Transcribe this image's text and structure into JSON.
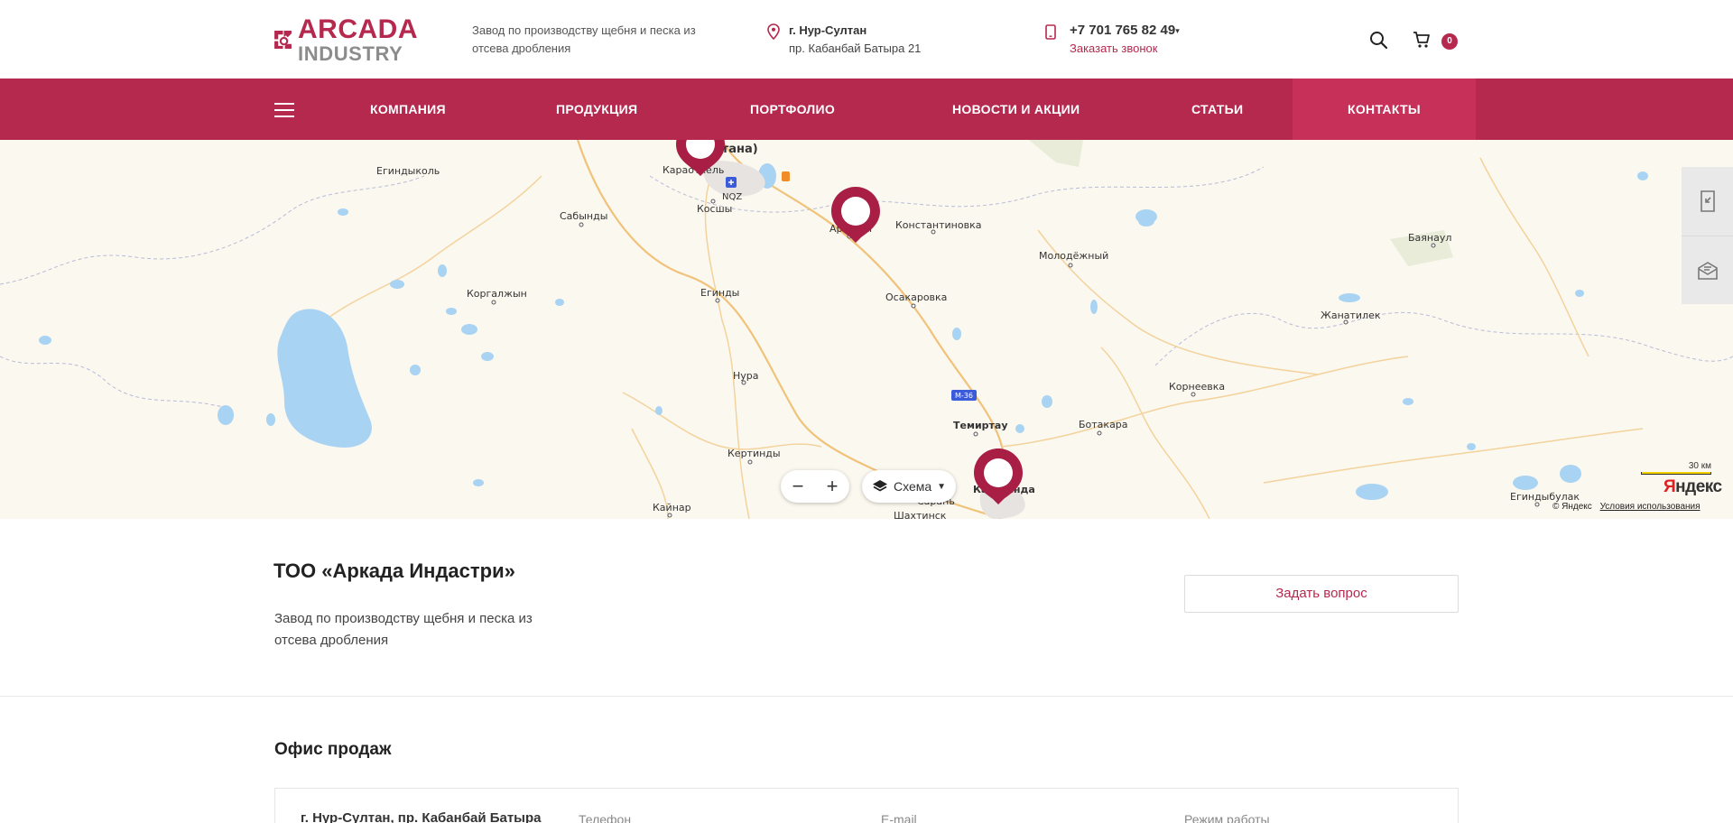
{
  "header": {
    "logo_line1": "ARCADA",
    "logo_line2": "INDUSTRY",
    "tagline": "Завод по производству щебня и песка из отсева дробления",
    "address_city": "г. Нур-Султан",
    "address_street": "пр. Кабанбай Батыра 21",
    "phone": "+7 701 765 82 49",
    "callback_label": "Заказать звонок",
    "cart_count": "0",
    "accent_color": "#b5294f"
  },
  "nav": {
    "items": [
      {
        "label": "Компания"
      },
      {
        "label": "Продукция"
      },
      {
        "label": "Портфолио"
      },
      {
        "label": "Новости и акции"
      },
      {
        "label": "Статьи"
      },
      {
        "label": "Контакты",
        "active": true
      }
    ]
  },
  "map": {
    "layer_label": "Схема",
    "scale_label": "30 км",
    "brand": "Яндекс",
    "copyright": "© Яндекс",
    "terms_label": "Условия использования",
    "road_label": "М-36",
    "airport_label": "NQZ",
    "places": [
      "(Астана)",
      "Егиндыколь",
      "Караоткель",
      "Косшы",
      "Сабынды",
      "Аршалы",
      "Константиновка",
      "Баянаул",
      "Молодёжный",
      "Коргалжын",
      "Егинды",
      "Осакаровка",
      "Жанатилек",
      "Нура",
      "Корнеевка",
      "Темиртау",
      "Ботакара",
      "Кертинды",
      "Караганда",
      "Сарань",
      "Кайнар",
      "Шахтинск",
      "Егиндыбулак"
    ]
  },
  "company": {
    "title": "ТОО «Аркада Индастри»",
    "description": "Завод по производству щебня и песка из отсева дробления",
    "ask_button": "Задать вопрос"
  },
  "office": {
    "title": "Офис продаж",
    "address": "г. Нур-Султан, пр. Кабанбай Батыра",
    "col_phone": "Телефон",
    "col_email": "E-mail",
    "col_hours": "Режим работы"
  }
}
